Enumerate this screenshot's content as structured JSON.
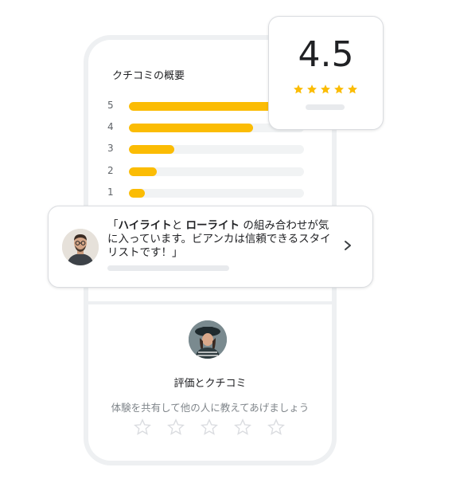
{
  "summary": {
    "title": "クチコミの概要",
    "bars": [
      {
        "label": "5",
        "fraction": 0.85
      },
      {
        "label": "4",
        "fraction": 0.71
      },
      {
        "label": "3",
        "fraction": 0.26
      },
      {
        "label": "2",
        "fraction": 0.16
      },
      {
        "label": "1",
        "fraction": 0.09
      }
    ]
  },
  "rating_card": {
    "value": "4.5",
    "stars": 5,
    "star_color": "#fbbc04"
  },
  "review": {
    "quote_open": "「",
    "highlight_1": "ハイライト",
    "text_1": "と",
    "highlight_2": "ローライト",
    "text_2": "の組み合わせが気に入っています。ビアンカは信頼できるスタイリストです！」",
    "avatar_icon": "man-avatar",
    "chevron_icon": "chevron-right-icon"
  },
  "compose": {
    "title": "評価とクチコミ",
    "subtitle": "体験を共有して他の人に教えてあげましょう",
    "star_count": 5,
    "avatar_icon": "woman-avatar"
  },
  "colors": {
    "accent": "#fbbc04",
    "track": "#f1f3f4",
    "placeholder": "#e8eaed"
  }
}
